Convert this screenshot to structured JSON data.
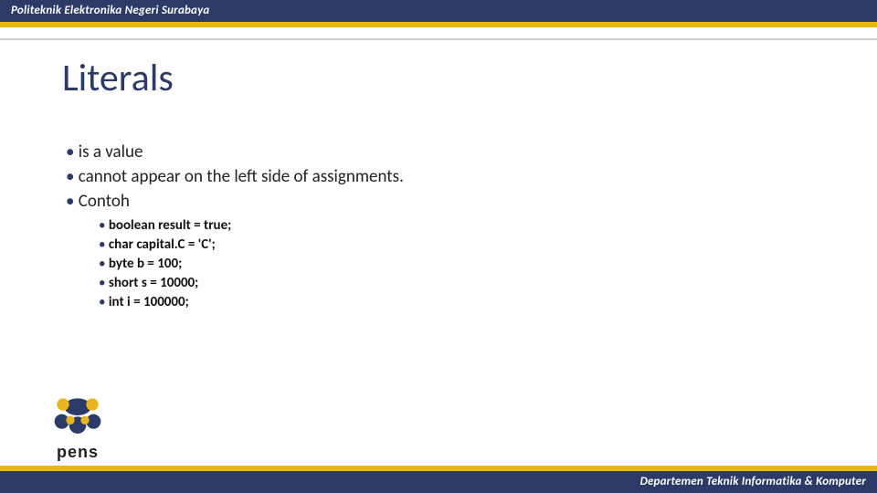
{
  "header": {
    "org": "Politeknik Elektronika Negeri Surabaya"
  },
  "footer": {
    "dept": "Departemen Teknik Informatika & Komputer"
  },
  "title": "Literals",
  "bullets": {
    "b1": "is a value",
    "b2": "cannot appear on the left side of assignments.",
    "b3": "Contoh"
  },
  "examples": {
    "e1": "boolean result = true;",
    "e2": "char capital.C = 'C';",
    "e3": "byte b = 100;",
    "e4": "short s = 10000;",
    "e5": "int i = 100000;"
  },
  "logo": {
    "text": "pens"
  }
}
